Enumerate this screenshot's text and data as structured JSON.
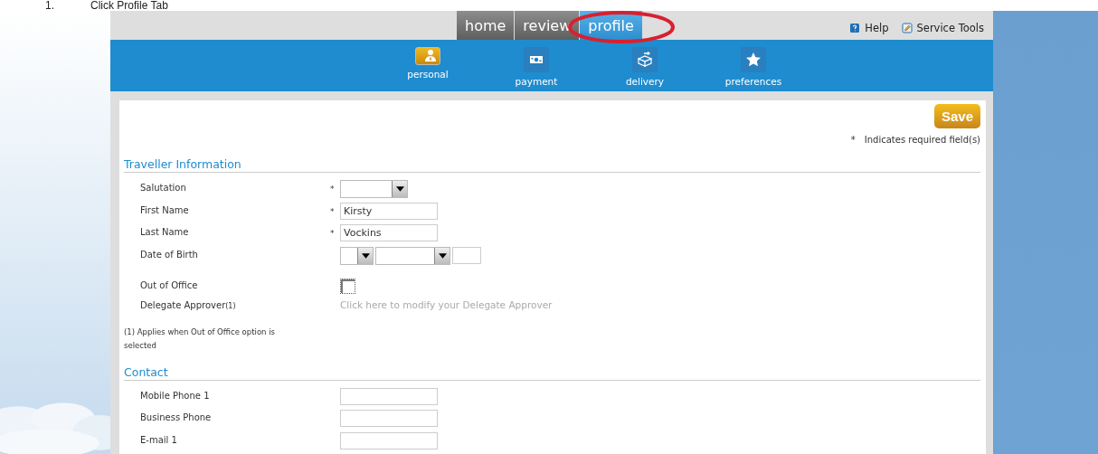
{
  "caption": {
    "number": "1.",
    "text": "Click Profile Tab"
  },
  "tabs": [
    {
      "label": "home",
      "selected": false
    },
    {
      "label": "review",
      "selected": false
    },
    {
      "label": "profile",
      "selected": true
    }
  ],
  "highlight": {
    "kind": "ellipse",
    "color": "#d9202f"
  },
  "header_links": [
    {
      "label": "Help",
      "kind": "help"
    },
    {
      "label": "Service Tools",
      "kind": "tools"
    }
  ],
  "subnav": [
    {
      "label": "personal",
      "kind": "personal",
      "selected": true
    },
    {
      "label": "payment",
      "kind": "payment",
      "selected": false
    },
    {
      "label": "delivery",
      "kind": "delivery",
      "selected": false
    },
    {
      "label": "preferences",
      "kind": "preferences",
      "selected": false
    }
  ],
  "save_button": "Save",
  "required_note": {
    "mark": "*",
    "text": "Indicates required field(s)"
  },
  "sections": [
    {
      "title": "Traveller Information",
      "rows": [
        {
          "label": "Salutation",
          "kind": "select",
          "required_mark": "*"
        },
        {
          "label": "First Name",
          "kind": "text",
          "required_mark": "*",
          "value": "Kirsty"
        },
        {
          "label": "Last Name",
          "kind": "text",
          "required_mark": "*",
          "value": "Vockins"
        },
        {
          "label": "Date of Birth",
          "kind": "date"
        },
        {
          "label": "Out of Office",
          "kind": "checkbox",
          "checked": false
        },
        {
          "label": "Delegate Approver",
          "footnote": "(1)",
          "kind": "link",
          "value": "Click here to modify your Delegate Approver"
        }
      ],
      "note": "(1) Applies when Out of Office option is selected"
    },
    {
      "title": "Contact",
      "rows": [
        {
          "label": "Mobile Phone 1",
          "kind": "text"
        },
        {
          "label": "Business Phone",
          "kind": "text"
        },
        {
          "label": "E-mail 1",
          "kind": "text"
        }
      ]
    }
  ]
}
